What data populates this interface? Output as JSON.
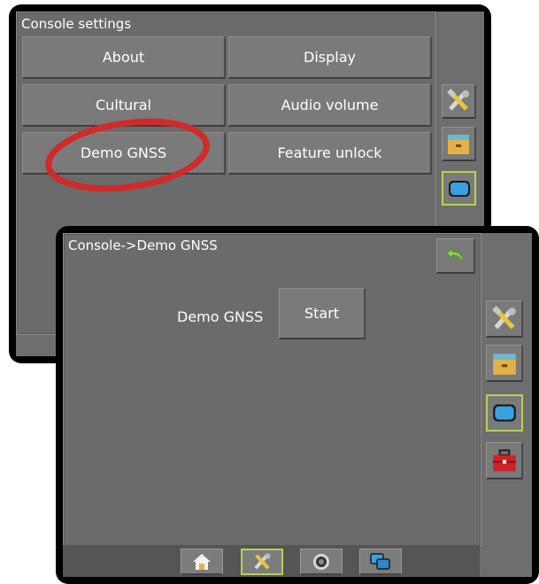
{
  "back_screen": {
    "title": "Console settings",
    "buttons": [
      "About",
      "Display",
      "Cultural",
      "Audio volume",
      "Demo GNSS",
      "Feature unlock"
    ],
    "side_icons": [
      "tools-icon",
      "storage-icon",
      "console-icon"
    ]
  },
  "front_screen": {
    "title": "Console->Demo GNSS",
    "demo_label": "Demo GNSS",
    "start_label": "Start",
    "side_icons": [
      "tools-icon",
      "storage-icon",
      "console-icon",
      "toolbox-icon"
    ],
    "tabbar_icons": [
      "home-icon",
      "tools-icon",
      "camera-icon",
      "screens-icon"
    ]
  },
  "colors": {
    "highlight_ellipse": "#d02a2a",
    "active_outline": "#b6d34a",
    "panel": "#6b6b6b"
  }
}
